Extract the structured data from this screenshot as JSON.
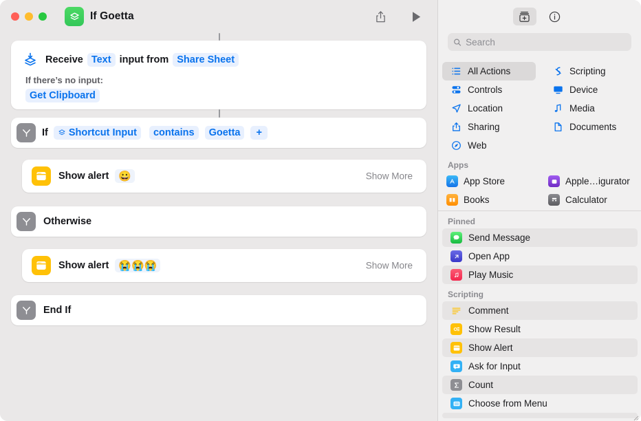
{
  "window": {
    "title": "If Goetta",
    "app_icon": "shortcuts-icon",
    "traffic_lights": [
      "close",
      "minimize",
      "zoom"
    ],
    "toolbar": {
      "share_label": "share-icon",
      "play_label": "play-icon"
    }
  },
  "editor": {
    "receive_card": {
      "icon": "receive-input-icon",
      "prefix": "Receive",
      "type_token": "Text",
      "middle": "input from",
      "source_token": "Share Sheet",
      "no_input_label": "If there’s no input:",
      "no_input_token": "Get Clipboard"
    },
    "if_card": {
      "icon": "branch-icon",
      "keyword": "If",
      "input_token": "Shortcut Input",
      "input_token_icon": "shortcut-input-icon",
      "operator_token": "contains",
      "value_token": "Goetta",
      "add_token": "+"
    },
    "alert_true": {
      "icon": "show-alert-icon",
      "label": "Show alert",
      "emoji": "😀",
      "show_more": "Show More"
    },
    "otherwise_card": {
      "icon": "branch-icon",
      "label": "Otherwise"
    },
    "alert_false": {
      "icon": "show-alert-icon",
      "label": "Show alert",
      "emoji": "😭😭😭",
      "show_more": "Show More"
    },
    "endif_card": {
      "icon": "branch-icon",
      "label": "End If"
    }
  },
  "library": {
    "toolbar": {
      "action_library_icon": "action-library-icon",
      "info_icon": "info-icon"
    },
    "search": {
      "placeholder": "Search",
      "value": "",
      "icon": "search-icon"
    },
    "categories": [
      {
        "label": "All Actions",
        "icon": "list-icon",
        "selected": true
      },
      {
        "label": "Scripting",
        "icon": "scripting-icon",
        "selected": false
      },
      {
        "label": "Controls",
        "icon": "controls-icon",
        "selected": false
      },
      {
        "label": "Device",
        "icon": "device-icon",
        "selected": false
      },
      {
        "label": "Location",
        "icon": "location-icon",
        "selected": false
      },
      {
        "label": "Media",
        "icon": "media-icon",
        "selected": false
      },
      {
        "label": "Sharing",
        "icon": "sharing-icon",
        "selected": false
      },
      {
        "label": "Documents",
        "icon": "documents-icon",
        "selected": false
      },
      {
        "label": "Web",
        "icon": "web-icon",
        "selected": false
      }
    ],
    "apps_section": {
      "title": "Apps",
      "items": [
        {
          "label": "App Store",
          "icon": "app-store-icon",
          "color": "#1d8cf5"
        },
        {
          "label": "Apple…igurator",
          "icon": "apple-configurator-icon",
          "color": "#8e44d6"
        },
        {
          "label": "Books",
          "icon": "books-icon",
          "color": "#ff9500"
        },
        {
          "label": "Calculator",
          "icon": "calculator-icon",
          "color": "#6e6e73"
        }
      ]
    },
    "pinned_section": {
      "title": "Pinned",
      "items": [
        {
          "label": "Send Message",
          "icon": "messages-icon",
          "color": "#34c759",
          "striped": true
        },
        {
          "label": "Open App",
          "icon": "open-app-icon",
          "color": "#4b4bd8",
          "striped": false
        },
        {
          "label": "Play Music",
          "icon": "play-music-icon",
          "color": "#fa2d48",
          "striped": true
        }
      ]
    },
    "scripting_section": {
      "title": "Scripting",
      "items": [
        {
          "label": "Comment",
          "icon": "comment-icon",
          "color": "#ffc107",
          "striped": true
        },
        {
          "label": "Show Result",
          "icon": "show-result-icon",
          "color": "#ffc107",
          "striped": false
        },
        {
          "label": "Show Alert",
          "icon": "show-alert-icon",
          "color": "#ffc107",
          "striped": true
        },
        {
          "label": "Ask for Input",
          "icon": "ask-for-input-icon",
          "color": "#33b1f5",
          "striped": false
        },
        {
          "label": "Count",
          "icon": "count-icon",
          "color": "#8e8e93",
          "striped": true
        },
        {
          "label": "Choose from Menu",
          "icon": "choose-from-menu-icon",
          "color": "#33b1f5",
          "striped": false
        }
      ]
    }
  },
  "colors": {
    "accent_blue": "#0a73ed",
    "token_bg": "#e8f0fe",
    "app_green": "#34c759",
    "action_yellow": "#ffc107",
    "gray_icon": "#8e8e93",
    "window_bg": "#eae8e8",
    "library_bg": "#f1f0f0"
  }
}
